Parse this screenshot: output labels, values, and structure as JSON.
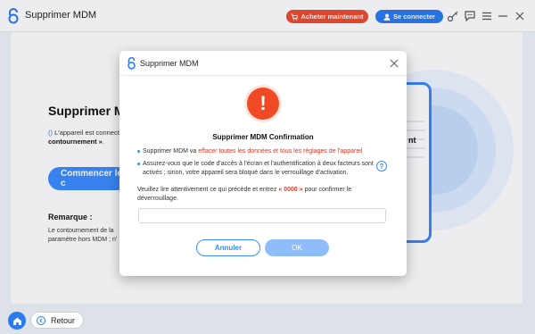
{
  "app": {
    "title": "Supprimer MDM",
    "buy_label": "Acheter maintenant",
    "login_label": "Se connecter"
  },
  "main": {
    "title": "Supprimer M",
    "desc_part1": "L'appareil est connecte",
    "desc_part2": "contournement »",
    "desc_part3": ".",
    "start_button": "Commencer le c",
    "remark_title": "Remarque :",
    "remark_line1": "Le contournement de la",
    "remark_line2": "paramètre hors MDM ; n'",
    "right_text": "nt"
  },
  "dialog": {
    "title": "Supprimer MDM",
    "confirm_title": "Supprimer MDM Confirmation",
    "bullet1_prefix": "Supprimer MDM va ",
    "bullet1_red": "effacer toutes les données et tous les réglages de l'appareil",
    "bullet2": "Assurez-vous que le code d'accès à l'écran et l'authentification à deux facteurs sont activés ; sinon, votre appareil sera bloqué dans le verrouillage d'activation.",
    "help_glyph": "?",
    "instruction_prefix": "Veuillez lire attentivement ce qui précède et entrez ",
    "instruction_code": "« 0000 »",
    "instruction_suffix": " pour confirmer le déverrouillage.",
    "input_value": "",
    "input_placeholder": "",
    "cancel_label": "Annuler",
    "ok_label": "OK"
  },
  "footer": {
    "back_label": "Retour"
  },
  "colors": {
    "accent": "#2a7bf0",
    "buy": "#f04a2e",
    "warning": "#ef4a23",
    "ok_disabled": "#8fbdfb"
  }
}
